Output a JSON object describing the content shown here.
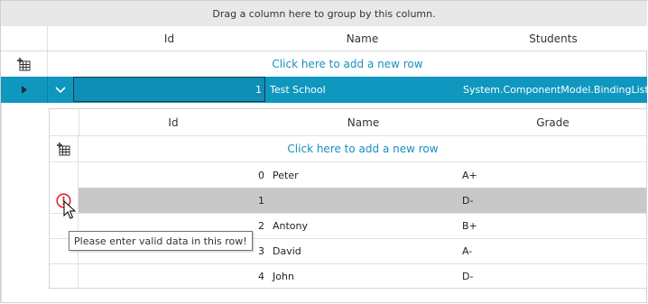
{
  "group_panel": {
    "text": "Drag a column here to group by this column."
  },
  "master": {
    "columns": [
      "Id",
      "Name",
      "Students"
    ],
    "add_row_text": "Click here to add a new row",
    "selected_row": {
      "id": "1",
      "name": "Test School",
      "students": "System.ComponentModel.BindingList`1..."
    }
  },
  "detail": {
    "columns": [
      "Id",
      "Name",
      "Grade"
    ],
    "add_row_text": "Click here to add a new row",
    "rows": [
      {
        "id": "0",
        "name": "Peter",
        "grade": "A+"
      },
      {
        "id": "1",
        "name": "",
        "grade": "D-"
      },
      {
        "id": "2",
        "name": "Antony",
        "grade": "B+"
      },
      {
        "id": "3",
        "name": "David",
        "grade": "A-"
      },
      {
        "id": "4",
        "name": "John",
        "grade": "D-"
      }
    ]
  },
  "tooltip": {
    "text": "Please enter valid data in this row!"
  },
  "icons": {
    "add_row": "add-row-icon",
    "expand": "chevron-right-icon",
    "collapse": "chevron-down-icon",
    "error": "error-icon",
    "cursor": "mouse-pointer-icon"
  },
  "colors": {
    "selection": "#0f97bf",
    "link": "#1a8fc0",
    "error_row": "#c8c8c8",
    "error_icon": "#d9282f"
  }
}
